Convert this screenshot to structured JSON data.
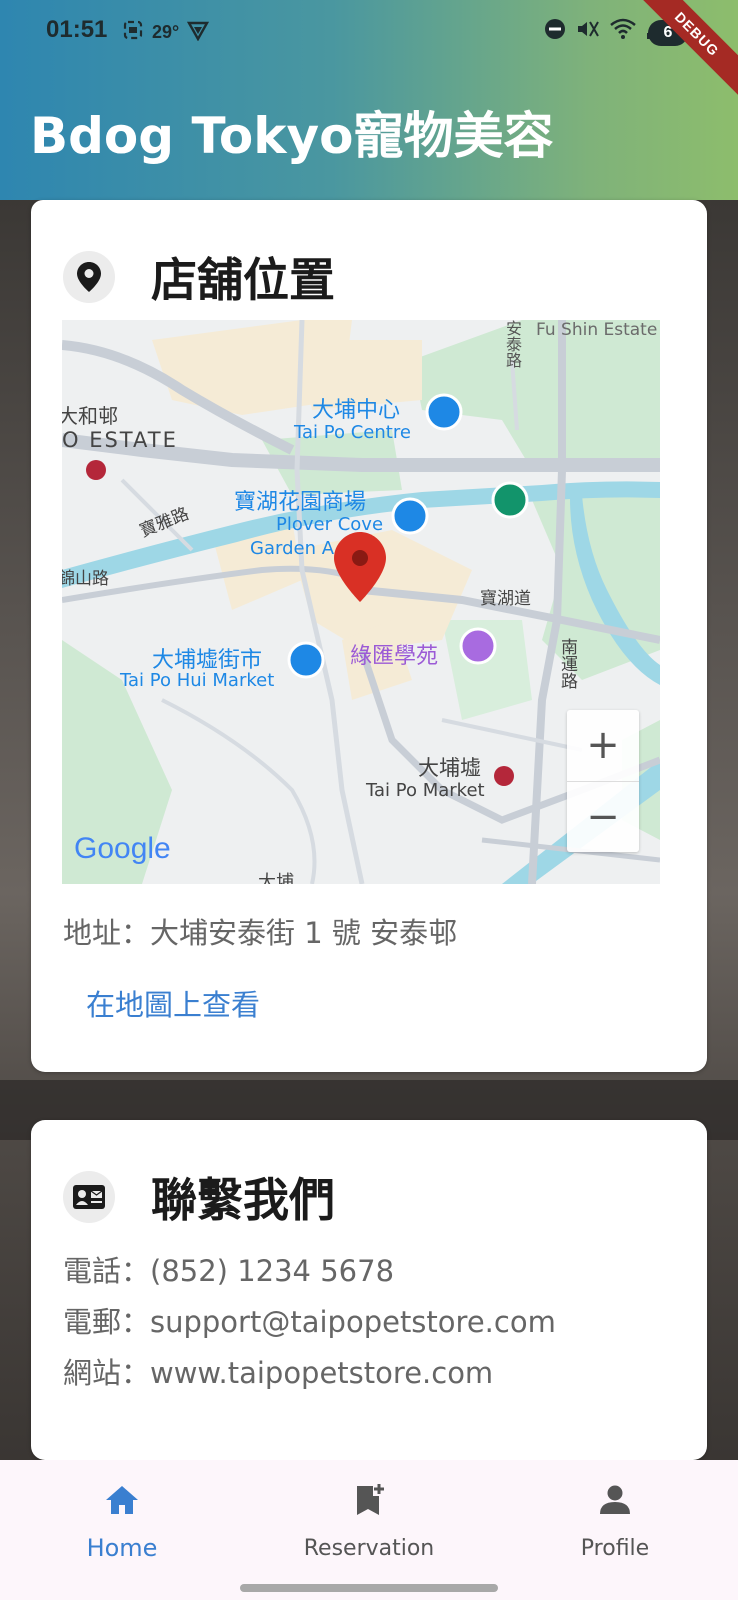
{
  "status_bar": {
    "time": "01:51",
    "temperature": "29°",
    "battery": "6"
  },
  "debug_banner": "DEBUG",
  "app_bar": {
    "title": "Bdog Tokyo寵物美容"
  },
  "location_card": {
    "title": "店舖位置",
    "map": {
      "labels": {
        "fu_shin": "Fu Shin Estate",
        "on_tai_road": "安泰路",
        "tai_wo_estate_cn": "大和邨",
        "tai_wo_estate_en": "O ESTATE",
        "tai_po_centre_cn": "大埔中心",
        "tai_po_centre_en": "Tai Po Centre",
        "plover_cove_cn": "寶湖花園商場",
        "plover_cove_en": "Plover Cove",
        "garden_a": "Garden A",
        "po_nga_road": "寶雅路",
        "kam_shan_road": "錦山路",
        "po_wu_road": "寶湖道",
        "green_hub": "綠匯學苑",
        "tai_po_hui_cn": "大埔墟街市",
        "tai_po_hui_en": "Tai Po Hui Market",
        "nam_wan_road": "南運路",
        "tai_po_market_cn": "大埔墟",
        "tai_po_market_en": "Tai Po Market",
        "tai_po_bottom": "大埔",
        "google": "Google"
      },
      "zoom_in": "+",
      "zoom_out": "−"
    },
    "address": "地址：大埔安泰街 1 號 安泰邨",
    "view_on_map": "在地圖上查看"
  },
  "contact_card": {
    "title": "聯繫我們",
    "phone": "電話：(852) 1234 5678",
    "email": "電郵：support@taipopetstore.com",
    "website": "網站：www.taipopetstore.com"
  },
  "bottom_nav": {
    "items": [
      {
        "label": "Home",
        "icon": "home-icon",
        "active": true
      },
      {
        "label": "Reservation",
        "icon": "bookmark-add-icon",
        "active": false
      },
      {
        "label": "Profile",
        "icon": "person-icon",
        "active": false
      }
    ]
  },
  "colors": {
    "accent": "#3a7fd0",
    "appbar_start": "#2e86b0",
    "appbar_end": "#8dbd6c",
    "map_pin": "#d93025"
  }
}
